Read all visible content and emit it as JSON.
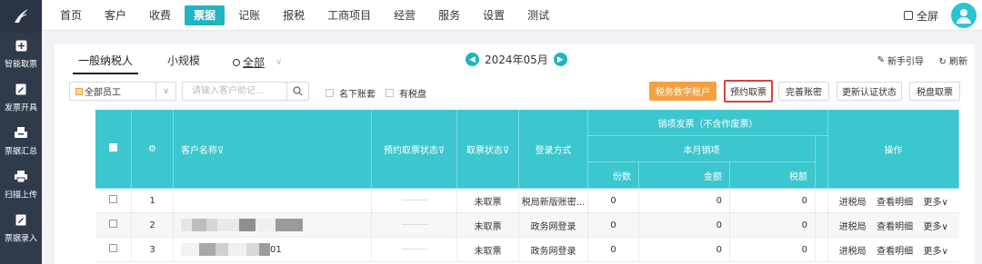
{
  "sidebar": {
    "items": [
      {
        "label": "智能取票",
        "icon": "plus-box-icon"
      },
      {
        "label": "发票开具",
        "icon": "edit-doc-icon"
      },
      {
        "label": "票据汇总",
        "icon": "tray-icon"
      },
      {
        "label": "扫描上传",
        "icon": "printer-icon"
      },
      {
        "label": "票据录入",
        "icon": "edit-doc-icon"
      }
    ]
  },
  "nav": {
    "items": [
      "首页",
      "客户",
      "收费",
      "票据",
      "记账",
      "报税",
      "工商项目",
      "经营",
      "服务",
      "设置",
      "测试"
    ],
    "active_index": 3,
    "fullscreen_label": "全屏"
  },
  "tabs": {
    "general": "一般纳税人",
    "small": "小规模",
    "all": "全部"
  },
  "month": {
    "label": "2024年05月"
  },
  "guide_label": "新手引导",
  "refresh_label": "刷新",
  "toolbar": {
    "employee_select": "全部员工",
    "search_placeholder": "请输入客户助记...",
    "check_my_books": "名下账套",
    "check_tax_disk": "有税盘",
    "btn_digital_account": "税务数字账户",
    "btn_reserve": "预约取票",
    "btn_complete_password": "完善账密",
    "btn_update_status": "更新认证状态",
    "btn_fetch_tickets": "税盘取票"
  },
  "table": {
    "headers": {
      "customer_name": "客户名称",
      "reserve_status": "预约取票状态",
      "fetch_status": "取票状态",
      "login_method": "登录方式",
      "sales_invoice": "销项发票（不含作废票）",
      "month_sales": "本月销项",
      "count": "份数",
      "amount": "金额",
      "tax": "税额",
      "operation": "操作"
    },
    "rows": [
      {
        "no": "1",
        "fetch_status": "未取票",
        "login": "税局新版账密...",
        "count": "0",
        "amount": "0",
        "tax": "0"
      },
      {
        "no": "2",
        "fetch_status": "未取票",
        "login": "政务网登录",
        "count": "0",
        "amount": "0",
        "tax": "0"
      },
      {
        "no": "3",
        "name_suffix": "01",
        "fetch_status": "未取票",
        "login": "政务网登录",
        "count": "0",
        "amount": "0",
        "tax": "0"
      }
    ],
    "ops": {
      "enter": "进税局",
      "detail": "查看明细",
      "more": "更多"
    }
  },
  "colors": {
    "accent": "#1fb4c0",
    "header_bg": "#3cc6ce",
    "orange": "#f5a041",
    "sidebar": "#2f3a4b",
    "highlight": "#d94040"
  }
}
